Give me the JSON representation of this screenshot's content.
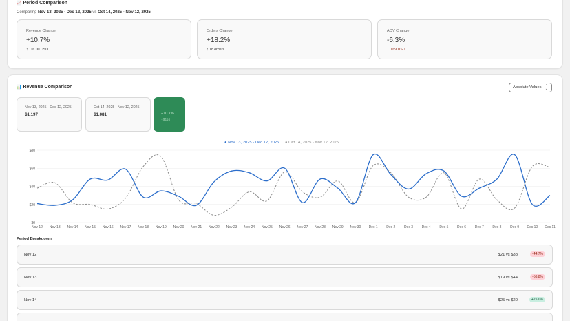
{
  "period_comparison": {
    "title": "Period Comparison",
    "icon": "chart-increasing-icon",
    "comparing_prefix": "Comparing",
    "current_range": "Nov 13, 2025 - Dec 12, 2025",
    "vs_label": "vs",
    "previous_range": "Oct 14, 2025 - Nov 12, 2025",
    "metrics": [
      {
        "label": "Revenue Change",
        "value": "+10.7%",
        "arrow": "↑",
        "detail": "116.00 USD",
        "trend": "up"
      },
      {
        "label": "Orders Change",
        "value": "+18.2%",
        "arrow": "↑",
        "detail": "18 orders",
        "trend": "up"
      },
      {
        "label": "AOV Change",
        "value": "-6.3%",
        "arrow": "↓",
        "detail": "0.69 USD",
        "trend": "down"
      }
    ]
  },
  "revenue_comparison": {
    "title": "Revenue Comparison",
    "icon": "bar-chart-icon",
    "select_value": "Absolute Values",
    "current": {
      "range": "Nov 13, 2025 - Dec 12, 2025",
      "total": "$1,197"
    },
    "previous": {
      "range": "Oct 14, 2025 - Nov 12, 2025",
      "total": "$1,081"
    },
    "delta": {
      "percent": "+10.7%",
      "amount": "+$116"
    }
  },
  "colors": {
    "current": "#2c6ecb",
    "previous": "#8a8a8a",
    "delta_bg": "#2e8b57"
  },
  "chart_data": {
    "type": "line",
    "x": [
      "Nov 12",
      "Nov 13",
      "Nov 14",
      "Nov 15",
      "Nov 16",
      "Nov 17",
      "Nov 18",
      "Nov 19",
      "Nov 20",
      "Nov 21",
      "Nov 22",
      "Nov 23",
      "Nov 24",
      "Nov 25",
      "Nov 26",
      "Nov 27",
      "Nov 28",
      "Nov 29",
      "Nov 30",
      "Dec 1",
      "Dec 2",
      "Dec 3",
      "Dec 4",
      "Dec 5",
      "Dec 6",
      "Dec 7",
      "Dec 8",
      "Dec 9",
      "Dec 10",
      "Dec 11"
    ],
    "series": [
      {
        "name": "Nov 13, 2025 - Dec 12, 2025",
        "style": "solid",
        "values": [
          21,
          19,
          25,
          48,
          47,
          59,
          28,
          35,
          29,
          19,
          45,
          57,
          55,
          46,
          60,
          22,
          48,
          38,
          22,
          75,
          53,
          37,
          54,
          57,
          29,
          38,
          48,
          75,
          20,
          30
        ]
      },
      {
        "name": "Oct 14, 2025 - Nov 12, 2025",
        "style": "dashed",
        "values": [
          38,
          44,
          22,
          20,
          15,
          27,
          62,
          73,
          25,
          21,
          8,
          17,
          34,
          24,
          56,
          34,
          28,
          46,
          22,
          63,
          55,
          28,
          28,
          55,
          15,
          48,
          25,
          16,
          62,
          61
        ]
      }
    ],
    "yticks": [
      "$0",
      "$20",
      "$40",
      "$60",
      "$80"
    ],
    "ylim": [
      0,
      80
    ],
    "grid": true,
    "legend": "top-center"
  },
  "breakdown": {
    "title": "Period Breakdown",
    "rows": [
      {
        "date": "Nov 12",
        "compare": "$21 vs $38",
        "change": "-44.7%",
        "trend": "neg"
      },
      {
        "date": "Nov 13",
        "compare": "$19 vs $44",
        "change": "-56.8%",
        "trend": "neg"
      },
      {
        "date": "Nov 14",
        "compare": "$25 vs $20",
        "change": "+25.0%",
        "trend": "pos"
      }
    ]
  }
}
